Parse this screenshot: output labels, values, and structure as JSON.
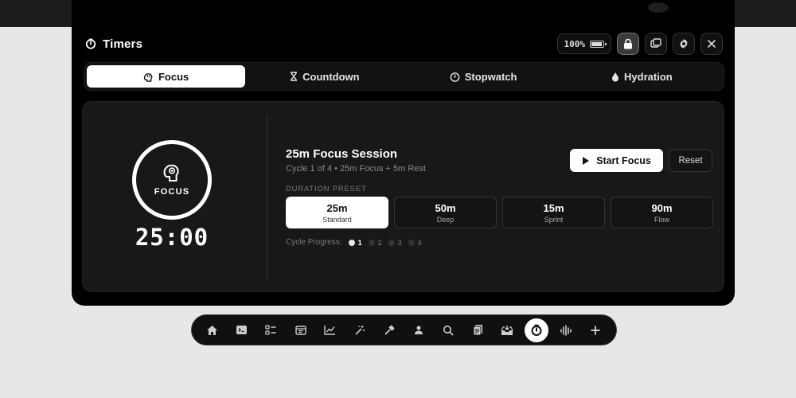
{
  "header": {
    "title": "Timers",
    "battery": "100%",
    "battery_fill": 0.9
  },
  "tabs": [
    {
      "label": "Focus",
      "icon": "brain-icon",
      "active": true
    },
    {
      "label": "Countdown",
      "icon": "hourglass-icon",
      "active": false
    },
    {
      "label": "Stopwatch",
      "icon": "stopwatch-icon",
      "active": false
    },
    {
      "label": "Hydration",
      "icon": "drop-icon",
      "active": false
    }
  ],
  "timer": {
    "ring_label": "FOCUS",
    "time": "25:00"
  },
  "session": {
    "title": "25m Focus Session",
    "subtitle": "Cycle 1 of 4 • 25m Focus + 5m Rest",
    "start_label": "Start Focus",
    "reset_label": "Reset"
  },
  "presets": {
    "label": "DURATION PRESET",
    "items": [
      {
        "value": "25m",
        "name": "Standard",
        "active": true
      },
      {
        "value": "50m",
        "name": "Deep",
        "active": false
      },
      {
        "value": "15m",
        "name": "Sprint",
        "active": false
      },
      {
        "value": "90m",
        "name": "Flow",
        "active": false
      }
    ]
  },
  "cycle": {
    "label": "Cycle Progress:",
    "steps": [
      "1",
      "2",
      "3",
      "4"
    ],
    "current": 1
  },
  "dock": [
    "home-icon",
    "terminal-icon",
    "checklist-icon",
    "calendar-icon",
    "chart-icon",
    "magic-wand-icon",
    "eyedropper-icon",
    "contact-icon",
    "search-icon",
    "documents-icon",
    "inbox-icon",
    "timer-icon",
    "waveform-icon",
    "plus-icon"
  ],
  "colors": {
    "accent": "#ffffff",
    "panel": "#181818",
    "background": "#e7e7e7"
  }
}
